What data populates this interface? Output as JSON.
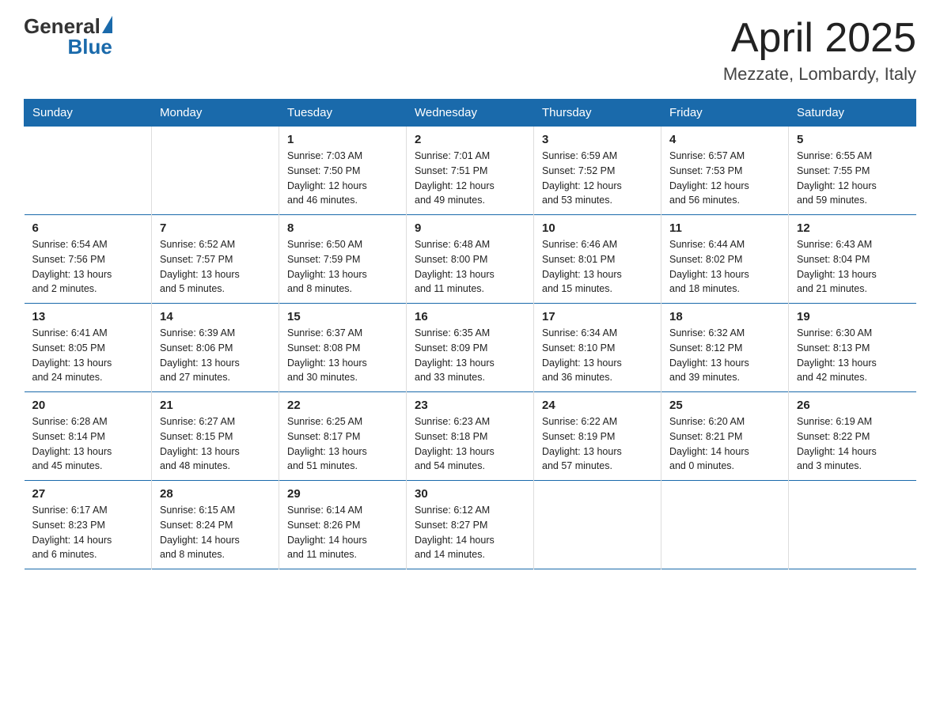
{
  "logo": {
    "general": "General",
    "blue": "Blue"
  },
  "title": "April 2025",
  "subtitle": "Mezzate, Lombardy, Italy",
  "weekdays": [
    "Sunday",
    "Monday",
    "Tuesday",
    "Wednesday",
    "Thursday",
    "Friday",
    "Saturday"
  ],
  "weeks": [
    [
      {
        "day": "",
        "info": ""
      },
      {
        "day": "",
        "info": ""
      },
      {
        "day": "1",
        "info": "Sunrise: 7:03 AM\nSunset: 7:50 PM\nDaylight: 12 hours\nand 46 minutes."
      },
      {
        "day": "2",
        "info": "Sunrise: 7:01 AM\nSunset: 7:51 PM\nDaylight: 12 hours\nand 49 minutes."
      },
      {
        "day": "3",
        "info": "Sunrise: 6:59 AM\nSunset: 7:52 PM\nDaylight: 12 hours\nand 53 minutes."
      },
      {
        "day": "4",
        "info": "Sunrise: 6:57 AM\nSunset: 7:53 PM\nDaylight: 12 hours\nand 56 minutes."
      },
      {
        "day": "5",
        "info": "Sunrise: 6:55 AM\nSunset: 7:55 PM\nDaylight: 12 hours\nand 59 minutes."
      }
    ],
    [
      {
        "day": "6",
        "info": "Sunrise: 6:54 AM\nSunset: 7:56 PM\nDaylight: 13 hours\nand 2 minutes."
      },
      {
        "day": "7",
        "info": "Sunrise: 6:52 AM\nSunset: 7:57 PM\nDaylight: 13 hours\nand 5 minutes."
      },
      {
        "day": "8",
        "info": "Sunrise: 6:50 AM\nSunset: 7:59 PM\nDaylight: 13 hours\nand 8 minutes."
      },
      {
        "day": "9",
        "info": "Sunrise: 6:48 AM\nSunset: 8:00 PM\nDaylight: 13 hours\nand 11 minutes."
      },
      {
        "day": "10",
        "info": "Sunrise: 6:46 AM\nSunset: 8:01 PM\nDaylight: 13 hours\nand 15 minutes."
      },
      {
        "day": "11",
        "info": "Sunrise: 6:44 AM\nSunset: 8:02 PM\nDaylight: 13 hours\nand 18 minutes."
      },
      {
        "day": "12",
        "info": "Sunrise: 6:43 AM\nSunset: 8:04 PM\nDaylight: 13 hours\nand 21 minutes."
      }
    ],
    [
      {
        "day": "13",
        "info": "Sunrise: 6:41 AM\nSunset: 8:05 PM\nDaylight: 13 hours\nand 24 minutes."
      },
      {
        "day": "14",
        "info": "Sunrise: 6:39 AM\nSunset: 8:06 PM\nDaylight: 13 hours\nand 27 minutes."
      },
      {
        "day": "15",
        "info": "Sunrise: 6:37 AM\nSunset: 8:08 PM\nDaylight: 13 hours\nand 30 minutes."
      },
      {
        "day": "16",
        "info": "Sunrise: 6:35 AM\nSunset: 8:09 PM\nDaylight: 13 hours\nand 33 minutes."
      },
      {
        "day": "17",
        "info": "Sunrise: 6:34 AM\nSunset: 8:10 PM\nDaylight: 13 hours\nand 36 minutes."
      },
      {
        "day": "18",
        "info": "Sunrise: 6:32 AM\nSunset: 8:12 PM\nDaylight: 13 hours\nand 39 minutes."
      },
      {
        "day": "19",
        "info": "Sunrise: 6:30 AM\nSunset: 8:13 PM\nDaylight: 13 hours\nand 42 minutes."
      }
    ],
    [
      {
        "day": "20",
        "info": "Sunrise: 6:28 AM\nSunset: 8:14 PM\nDaylight: 13 hours\nand 45 minutes."
      },
      {
        "day": "21",
        "info": "Sunrise: 6:27 AM\nSunset: 8:15 PM\nDaylight: 13 hours\nand 48 minutes."
      },
      {
        "day": "22",
        "info": "Sunrise: 6:25 AM\nSunset: 8:17 PM\nDaylight: 13 hours\nand 51 minutes."
      },
      {
        "day": "23",
        "info": "Sunrise: 6:23 AM\nSunset: 8:18 PM\nDaylight: 13 hours\nand 54 minutes."
      },
      {
        "day": "24",
        "info": "Sunrise: 6:22 AM\nSunset: 8:19 PM\nDaylight: 13 hours\nand 57 minutes."
      },
      {
        "day": "25",
        "info": "Sunrise: 6:20 AM\nSunset: 8:21 PM\nDaylight: 14 hours\nand 0 minutes."
      },
      {
        "day": "26",
        "info": "Sunrise: 6:19 AM\nSunset: 8:22 PM\nDaylight: 14 hours\nand 3 minutes."
      }
    ],
    [
      {
        "day": "27",
        "info": "Sunrise: 6:17 AM\nSunset: 8:23 PM\nDaylight: 14 hours\nand 6 minutes."
      },
      {
        "day": "28",
        "info": "Sunrise: 6:15 AM\nSunset: 8:24 PM\nDaylight: 14 hours\nand 8 minutes."
      },
      {
        "day": "29",
        "info": "Sunrise: 6:14 AM\nSunset: 8:26 PM\nDaylight: 14 hours\nand 11 minutes."
      },
      {
        "day": "30",
        "info": "Sunrise: 6:12 AM\nSunset: 8:27 PM\nDaylight: 14 hours\nand 14 minutes."
      },
      {
        "day": "",
        "info": ""
      },
      {
        "day": "",
        "info": ""
      },
      {
        "day": "",
        "info": ""
      }
    ]
  ]
}
